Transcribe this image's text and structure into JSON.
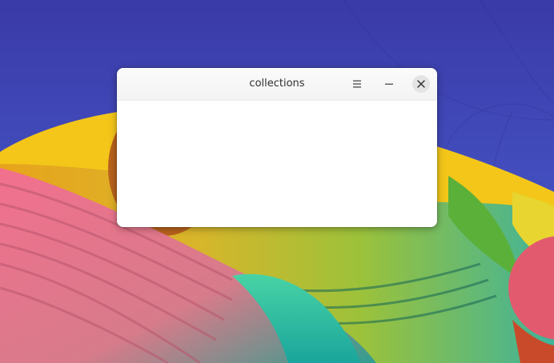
{
  "window": {
    "title": "collections"
  },
  "headerbar": {
    "menu_icon": "hamburger-menu-icon",
    "minimize_icon": "minimize-icon",
    "close_icon": "close-icon"
  },
  "colors": {
    "desktop_top": "#3a3aa8",
    "desktop_bottom": "#4a63cf",
    "window_bg": "#ffffff",
    "headerbar_bg": "#f6f6f6",
    "close_button_bg": "#e4e4e4"
  }
}
